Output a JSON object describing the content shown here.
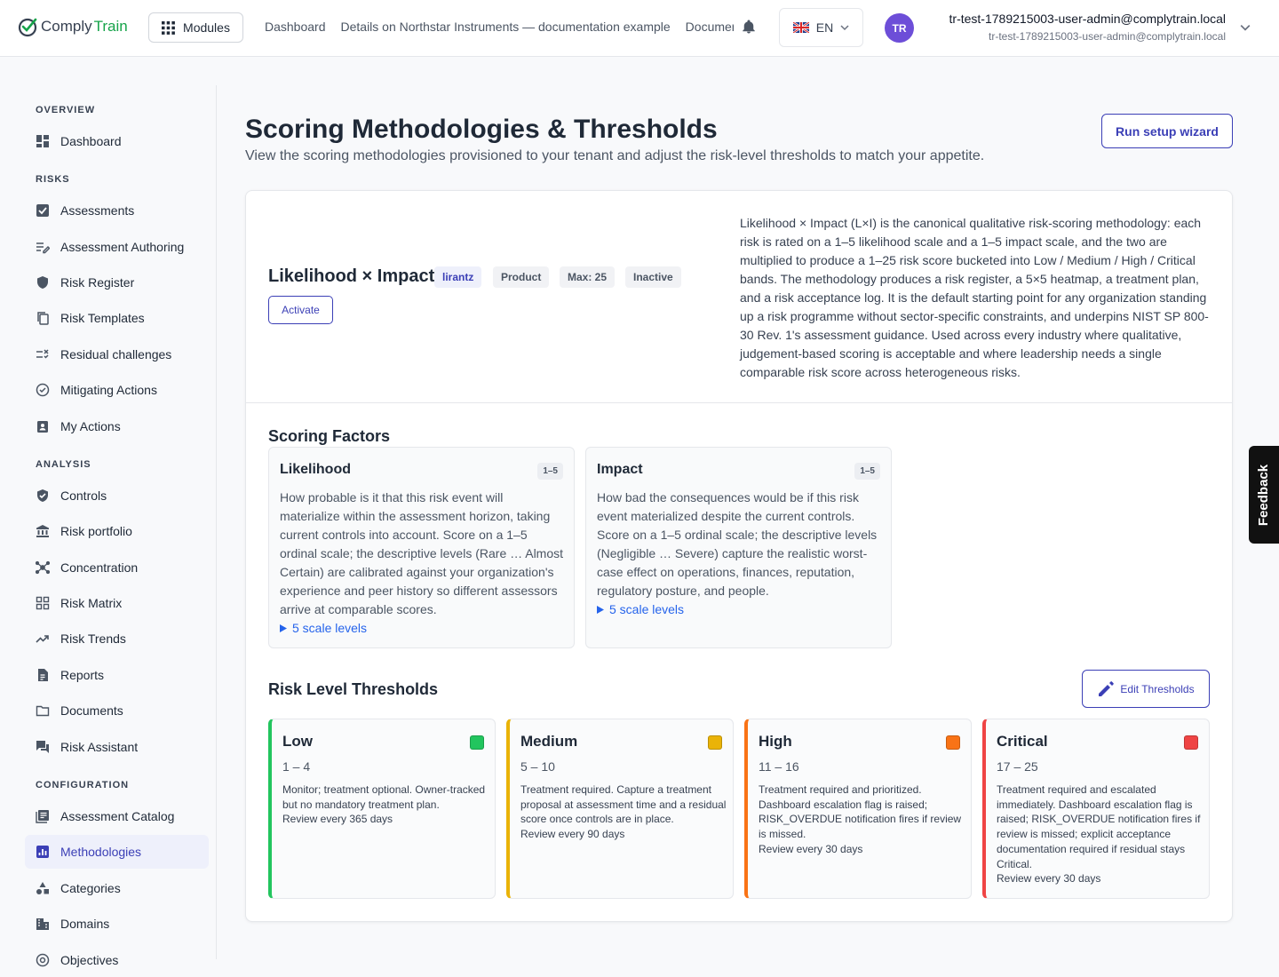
{
  "brand": {
    "name_a": "Comply",
    "name_b": "Train"
  },
  "header": {
    "modules_label": "Modules",
    "breadcrumbs": [
      "Dashboard",
      "Details on Northstar Instruments — documentation example",
      "Documents"
    ],
    "language": "EN",
    "avatar_initials": "TR",
    "user_name": "tr-test-1789215003-user-admin@complytrain.local",
    "user_email": "tr-test-1789215003-user-admin@complytrain.local"
  },
  "sidebar": {
    "sections": {
      "overview": "OVERVIEW",
      "risks": "RISKS",
      "analysis": "ANALYSIS",
      "configuration": "CONFIGURATION"
    },
    "items": [
      {
        "label": "Dashboard",
        "icon": "dashboard-icon"
      },
      {
        "label": "Assessments",
        "icon": "checkbox-icon"
      },
      {
        "label": "Assessment Authoring",
        "icon": "edit-list-icon"
      },
      {
        "label": "Risk Register",
        "icon": "shield-icon"
      },
      {
        "label": "Risk Templates",
        "icon": "copy-icon"
      },
      {
        "label": "Residual challenges",
        "icon": "rule-icon"
      },
      {
        "label": "Mitigating Actions",
        "icon": "check-circle-icon"
      },
      {
        "label": "My Actions",
        "icon": "assignment-icon"
      },
      {
        "label": "Controls",
        "icon": "verified-shield-icon"
      },
      {
        "label": "Risk portfolio",
        "icon": "bank-icon"
      },
      {
        "label": "Concentration",
        "icon": "hub-icon"
      },
      {
        "label": "Risk Matrix",
        "icon": "grid-icon"
      },
      {
        "label": "Risk Trends",
        "icon": "trending-icon"
      },
      {
        "label": "Reports",
        "icon": "report-icon"
      },
      {
        "label": "Documents",
        "icon": "folder-icon"
      },
      {
        "label": "Risk Assistant",
        "icon": "chat-icon"
      },
      {
        "label": "Assessment Catalog",
        "icon": "catalog-icon"
      },
      {
        "label": "Methodologies",
        "icon": "methodology-icon",
        "active": true
      },
      {
        "label": "Categories",
        "icon": "category-icon"
      },
      {
        "label": "Domains",
        "icon": "domain-icon"
      },
      {
        "label": "Objectives",
        "icon": "objective-icon"
      }
    ]
  },
  "page": {
    "title": "Scoring Methodologies & Thresholds",
    "subtitle": "View the scoring methodologies provisioned to your tenant and adjust the risk-level thresholds to match your appetite.",
    "wizard_label": "Run setup wizard"
  },
  "methodology": {
    "name": "Likelihood × Impact",
    "badges": [
      "lirantz",
      "Product",
      "Max: 25",
      "Inactive"
    ],
    "activate_label": "Activate",
    "description": "Likelihood × Impact (L×I) is the canonical qualitative risk-scoring methodology: each risk is rated on a 1–5 likelihood scale and a 1–5 impact scale, and the two are multiplied to produce a 1–25 risk score bucketed into Low / Medium / High / Critical bands. The methodology produces a risk register, a 5×5 heatmap, a treatment plan, and a risk acceptance log. It is the default starting point for any organization standing up a risk programme without sector-specific constraints, and underpins NIST SP 800-30 Rev. 1's assessment guidance. Used across every industry where qualitative, judgement-based scoring is acceptable and where leadership needs a single comparable risk score across heterogeneous risks."
  },
  "factors": {
    "heading": "Scoring Factors",
    "items": [
      {
        "name": "Likelihood",
        "range": "1–5",
        "description": "How probable is it that this risk event will materialize within the assessment horizon, taking current controls into account. Score on a 1–5 ordinal scale; the descriptive levels (Rare … Almost Certain) are calibrated against your organization's experience and peer history so different assessors arrive at comparable scores.",
        "levels_label": "5 scale levels"
      },
      {
        "name": "Impact",
        "range": "1–5",
        "description": "How bad the consequences would be if this risk event materialized despite the current controls. Score on a 1–5 ordinal scale; the descriptive levels (Negligible … Severe) capture the realistic worst-case effect on operations, finances, reputation, regulatory posture, and people.",
        "levels_label": "5 scale levels"
      }
    ]
  },
  "thresholds": {
    "heading": "Risk Level Thresholds",
    "edit_label": "Edit Thresholds",
    "items": [
      {
        "name": "Low",
        "range": "1 – 4",
        "color": "#22c55e",
        "description": "Monitor; treatment optional. Owner-tracked but no mandatory treatment plan.",
        "review": "Review every 365 days"
      },
      {
        "name": "Medium",
        "range": "5 – 10",
        "color": "#eab308",
        "description": "Treatment required. Capture a treatment proposal at assessment time and a residual score once controls are in place.",
        "review": "Review every 90 days"
      },
      {
        "name": "High",
        "range": "11 – 16",
        "color": "#f97316",
        "description": "Treatment required and prioritized. Dashboard escalation flag is raised; RISK_OVERDUE notification fires if review is missed.",
        "review": "Review every 30 days"
      },
      {
        "name": "Critical",
        "range": "17 – 25",
        "color": "#ef4444",
        "description": "Treatment required and escalated immediately. Dashboard escalation flag is raised; RISK_OVERDUE notification fires if review is missed; explicit acceptance documentation required if residual stays Critical.",
        "review": "Review every 30 days"
      }
    ]
  },
  "feedback_label": "Feedback"
}
